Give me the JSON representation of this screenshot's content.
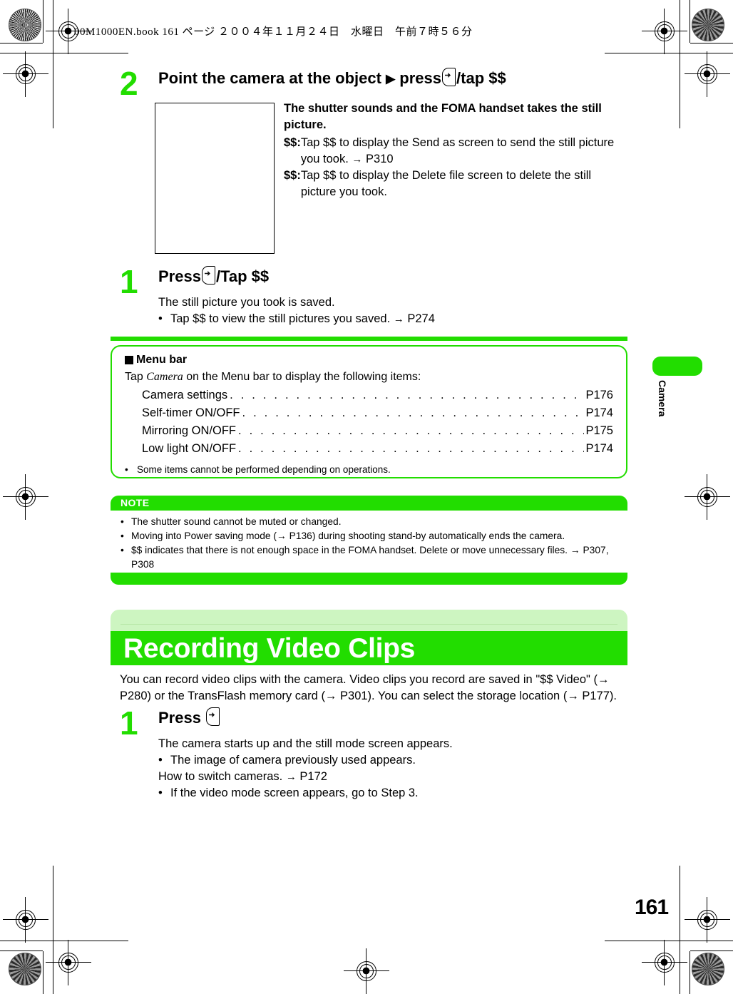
{
  "print_header": {
    "slug": "00M1000EN.book   161 ページ   ２００４年１１月２４日　水曜日　午前７時５６分"
  },
  "colors": {
    "accent_green": "#22dd00",
    "tint_green": "#cdf5c1",
    "black": "#000000",
    "white": "#ffffff"
  },
  "step2": {
    "number": "2",
    "title_a": "Point the camera at the object",
    "title_triangle": "▶",
    "title_b": "press",
    "title_icon": "key-icon",
    "title_c": "/tap $$",
    "result_bold": "The shutter sounds and the FOMA handset takes the still picture.",
    "notes": [
      {
        "prefix": "$$:",
        "text": "Tap $$ to display the Send as screen to send the still picture you took.",
        "arrow": "→",
        "page": "P310"
      },
      {
        "prefix": "$$:",
        "text": "Tap $$ to display the Delete file screen to delete the still picture you took.",
        "arrow": "",
        "page": ""
      }
    ]
  },
  "step1a": {
    "number": "1",
    "title_a": "Press",
    "title_icon": "key-icon",
    "title_b": "/Tap $$",
    "result": "The still picture you took is saved.",
    "bullets": [
      {
        "dot": "•",
        "text": "Tap $$ to view the still pictures you saved.",
        "arrow": "→",
        "page": "P274"
      }
    ]
  },
  "menu_bar_box": {
    "heading": "Menu bar",
    "intro_pre": "Tap ",
    "intro_italic": "Camera",
    "intro_post": " on the Menu bar to display the following items:",
    "items": [
      {
        "label": "Camera settings",
        "page": "P176"
      },
      {
        "label": "Self-timer ON/OFF",
        "page": "P174"
      },
      {
        "label": "Mirroring ON/OFF",
        "page": "P175"
      },
      {
        "label": "Low light ON/OFF",
        "page": "P174"
      }
    ],
    "footnote_dot": "•",
    "footnote": "Some items cannot be performed depending on operations."
  },
  "note_box": {
    "title": "NOTE",
    "lines": [
      {
        "dot": "•",
        "text": "The shutter sound cannot be muted or changed."
      },
      {
        "dot": "•",
        "text": "Moving into Power saving mode (→ P136) during shooting stand-by automatically ends the camera."
      },
      {
        "dot": "•",
        "text": "$$ indicates that there is not enough space in the FOMA handset. Delete or move unnecessary files. → P307, P308"
      }
    ]
  },
  "section": {
    "title": "Recording Video Clips",
    "intro": "You can record video clips with the camera. Video clips you record are saved in \"$$ Video\" (→ P280) or the TransFlash memory card (→ P301). You can select the storage location (→ P177)."
  },
  "step1b": {
    "number": "1",
    "title_a": "Press",
    "title_icon": "key-icon",
    "result": "The camera starts up and the still mode screen appears.",
    "bullets": [
      {
        "dot": "•",
        "text": "The image of camera previously used appears."
      }
    ],
    "plain_line": "How to switch cameras.",
    "plain_arrow": "→",
    "plain_page": "P172",
    "bullets2": [
      {
        "dot": "•",
        "text": "If the video mode screen appears, go to Step 3."
      }
    ]
  },
  "side_tab": {
    "label": "Camera"
  },
  "footer": {
    "page_number": "161"
  }
}
